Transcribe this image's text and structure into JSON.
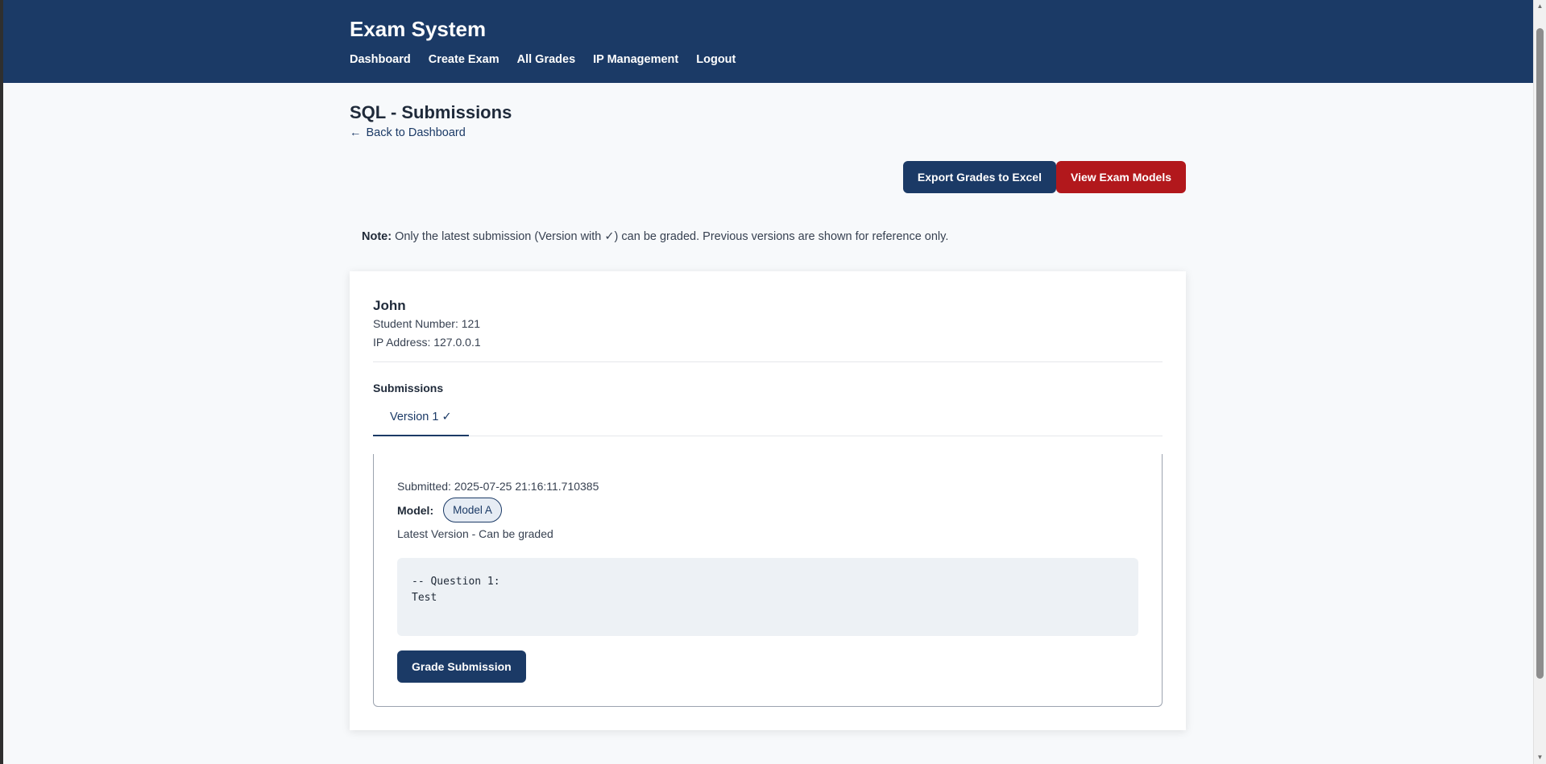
{
  "header": {
    "title": "Exam System",
    "nav": [
      "Dashboard",
      "Create Exam",
      "All Grades",
      "IP Management",
      "Logout"
    ]
  },
  "page": {
    "title": "SQL - Submissions",
    "back_arrow": "←",
    "back_label": "Back to Dashboard"
  },
  "actions": {
    "export_label": "Export Grades to Excel",
    "models_label": "View Exam Models"
  },
  "note": {
    "label": "Note:",
    "text": "Only the latest submission (Version with ✓) can be graded. Previous versions are shown for reference only."
  },
  "student": {
    "name": "John",
    "number": "Student Number: 121",
    "ip": "IP Address: 127.0.0.1",
    "submissions_label": "Submissions",
    "tabs": [
      "Version 1 ✓"
    ],
    "submission": {
      "submitted": "Submitted: 2025-07-25 21:16:11.710385",
      "model_label": "Model:",
      "model_value": "Model A",
      "status": "Latest Version - Can be graded",
      "code": "-- Question 1:\nTest",
      "grade_label": "Grade Submission"
    }
  },
  "colors": {
    "primary": "#1b3a66",
    "danger": "#b2181c",
    "background": "#f7f9fb"
  },
  "icons": {
    "scroll_up": "triangle-up-icon",
    "scroll_down": "triangle-down-icon"
  }
}
